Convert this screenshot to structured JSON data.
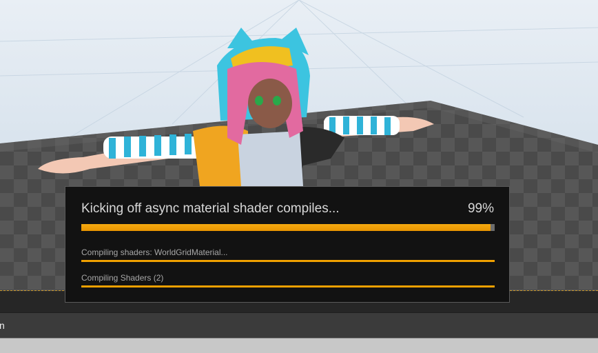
{
  "progress_dialog": {
    "main_task": "Kicking off async material shader compiles...",
    "main_percent_text": "99%",
    "main_progress": 0.99,
    "subtasks": [
      {
        "label": "Compiling shaders: WorldGridMaterial...",
        "progress": 1.0
      },
      {
        "label": "Compiling Shaders (2)",
        "progress": 1.0
      }
    ]
  },
  "status_bar": {
    "label_fragment": "n"
  },
  "colors": {
    "progress_fill": "#f0a000",
    "dialog_background": "#121212",
    "viewport_sky": "#dbe5ef"
  }
}
